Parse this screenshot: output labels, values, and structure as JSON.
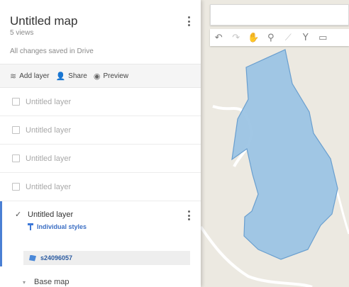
{
  "map": {
    "toolbar": [
      {
        "name": "undo-icon",
        "glyph": "↶",
        "enabled": true
      },
      {
        "name": "redo-icon",
        "glyph": "↷",
        "enabled": false
      },
      {
        "name": "pan-hand-icon",
        "glyph": "✋",
        "enabled": false
      },
      {
        "name": "add-marker-icon",
        "glyph": "⚲",
        "enabled": true
      },
      {
        "name": "draw-line-icon",
        "glyph": "⟋",
        "enabled": false
      },
      {
        "name": "route-icon",
        "glyph": "Y",
        "enabled": true
      },
      {
        "name": "ruler-icon",
        "glyph": "▭",
        "enabled": true
      }
    ],
    "colors": {
      "land": "#ece9e1",
      "road": "#ffffff",
      "polygon_fill": "#9cc4e4",
      "polygon_stroke": "#6a9fcf"
    }
  },
  "panel": {
    "title": "Untitled map",
    "views": "5 views",
    "saved_status": "All changes saved in Drive",
    "actions": {
      "add_layer": "Add layer",
      "share": "Share",
      "preview": "Preview"
    },
    "layers": [
      {
        "name": "Untitled layer",
        "checked": false
      },
      {
        "name": "Untitled layer",
        "checked": false
      },
      {
        "name": "Untitled layer",
        "checked": false
      },
      {
        "name": "Untitled layer",
        "checked": false
      }
    ],
    "active_layer": {
      "name": "Untitled layer",
      "checked": true,
      "style_label": "Individual styles",
      "feature_name": "s24096057"
    },
    "base_map": "Base map",
    "accent_color": "#4a7fd4"
  }
}
